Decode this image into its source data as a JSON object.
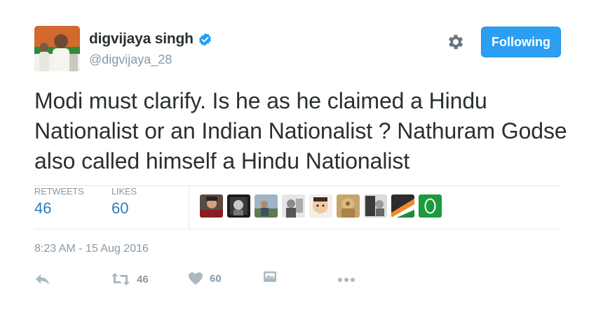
{
  "author": {
    "display_name": "digvijaya singh",
    "handle": "@digvijaya_28",
    "verified": true
  },
  "follow_button": {
    "label": "Following"
  },
  "tweet": {
    "text": "Modi must clarify. Is he as he claimed a Hindu Nationalist or an Indian Nationalist ? Nathuram Godse also called himself a Hindu Nationalist"
  },
  "stats": {
    "retweets": {
      "label": "RETWEETS",
      "value": "46"
    },
    "likes": {
      "label": "LIKES",
      "value": "60"
    }
  },
  "timestamp": "8:23 AM - 15 Aug 2016",
  "actions": {
    "retweet_count": "46",
    "like_count": "60"
  },
  "colors": {
    "brand_blue": "#2b9ff1",
    "verified_blue": "#1da1f2",
    "stat_blue": "#2b7bb9",
    "muted": "#8899a6",
    "divider": "#e1e8ed"
  },
  "icons": [
    "verified-icon",
    "gear-icon",
    "reply-icon",
    "retweet-icon",
    "heart-icon",
    "moments-icon",
    "more-icon"
  ]
}
